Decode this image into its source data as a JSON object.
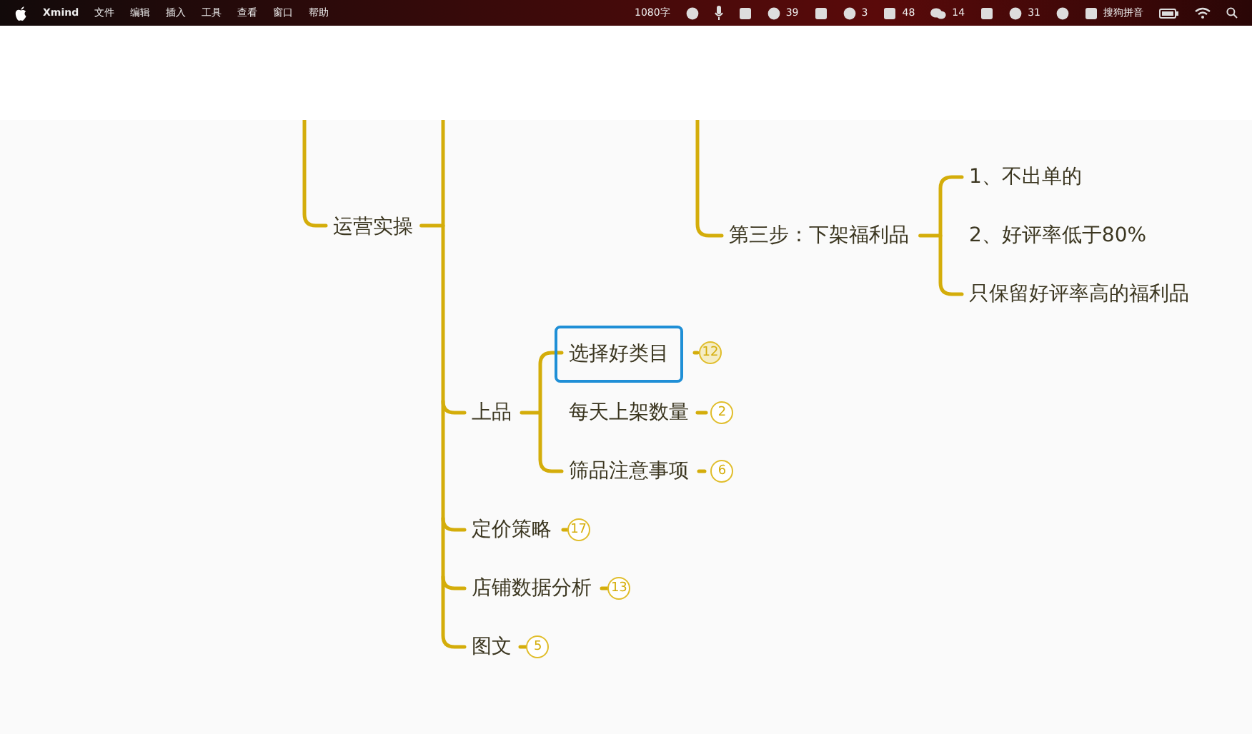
{
  "menu_bar": {
    "app": "Xmind",
    "menus": [
      "文件",
      "编辑",
      "插入",
      "工具",
      "查看",
      "窗口",
      "帮助"
    ],
    "status_items": [
      {
        "kind": "text",
        "text": "1080字"
      },
      {
        "kind": "circle"
      },
      {
        "kind": "mic"
      },
      {
        "kind": "square"
      },
      {
        "kind": "circle",
        "text": "39"
      },
      {
        "kind": "square"
      },
      {
        "kind": "circle",
        "text": "3"
      },
      {
        "kind": "square",
        "text": "48"
      },
      {
        "kind": "chat",
        "text": "14"
      },
      {
        "kind": "square"
      },
      {
        "kind": "circle",
        "text": "31"
      },
      {
        "kind": "circle"
      },
      {
        "kind": "square",
        "text": "搜狗拼音"
      },
      {
        "kind": "battery"
      },
      {
        "kind": "wifi"
      },
      {
        "kind": "search"
      }
    ]
  },
  "mind_map": {
    "upper_branch": {
      "label": "第三步：下架福利品",
      "selected": false,
      "children": [
        {
          "label": "1、不出单的",
          "selected": false
        },
        {
          "label": "2、好评率低于80%",
          "selected": false
        },
        {
          "label": "只保留好评率高的福利品",
          "selected": false
        }
      ]
    },
    "topic": {
      "label": "运营实操",
      "selected": false,
      "children": [
        {
          "label": "上品",
          "selected": false,
          "children": [
            {
              "label": "选择好类目",
              "selected": true,
              "count": "12"
            },
            {
              "label": "每天上架数量",
              "selected": false,
              "count": "2"
            },
            {
              "label": "筛品注意事项",
              "selected": false,
              "count": "6"
            }
          ]
        },
        {
          "label": "定价策略",
          "selected": false,
          "count": "17"
        },
        {
          "label": "店铺数据分析",
          "selected": false,
          "count": "13"
        },
        {
          "label": "图文",
          "selected": false,
          "count": "5"
        }
      ]
    }
  }
}
